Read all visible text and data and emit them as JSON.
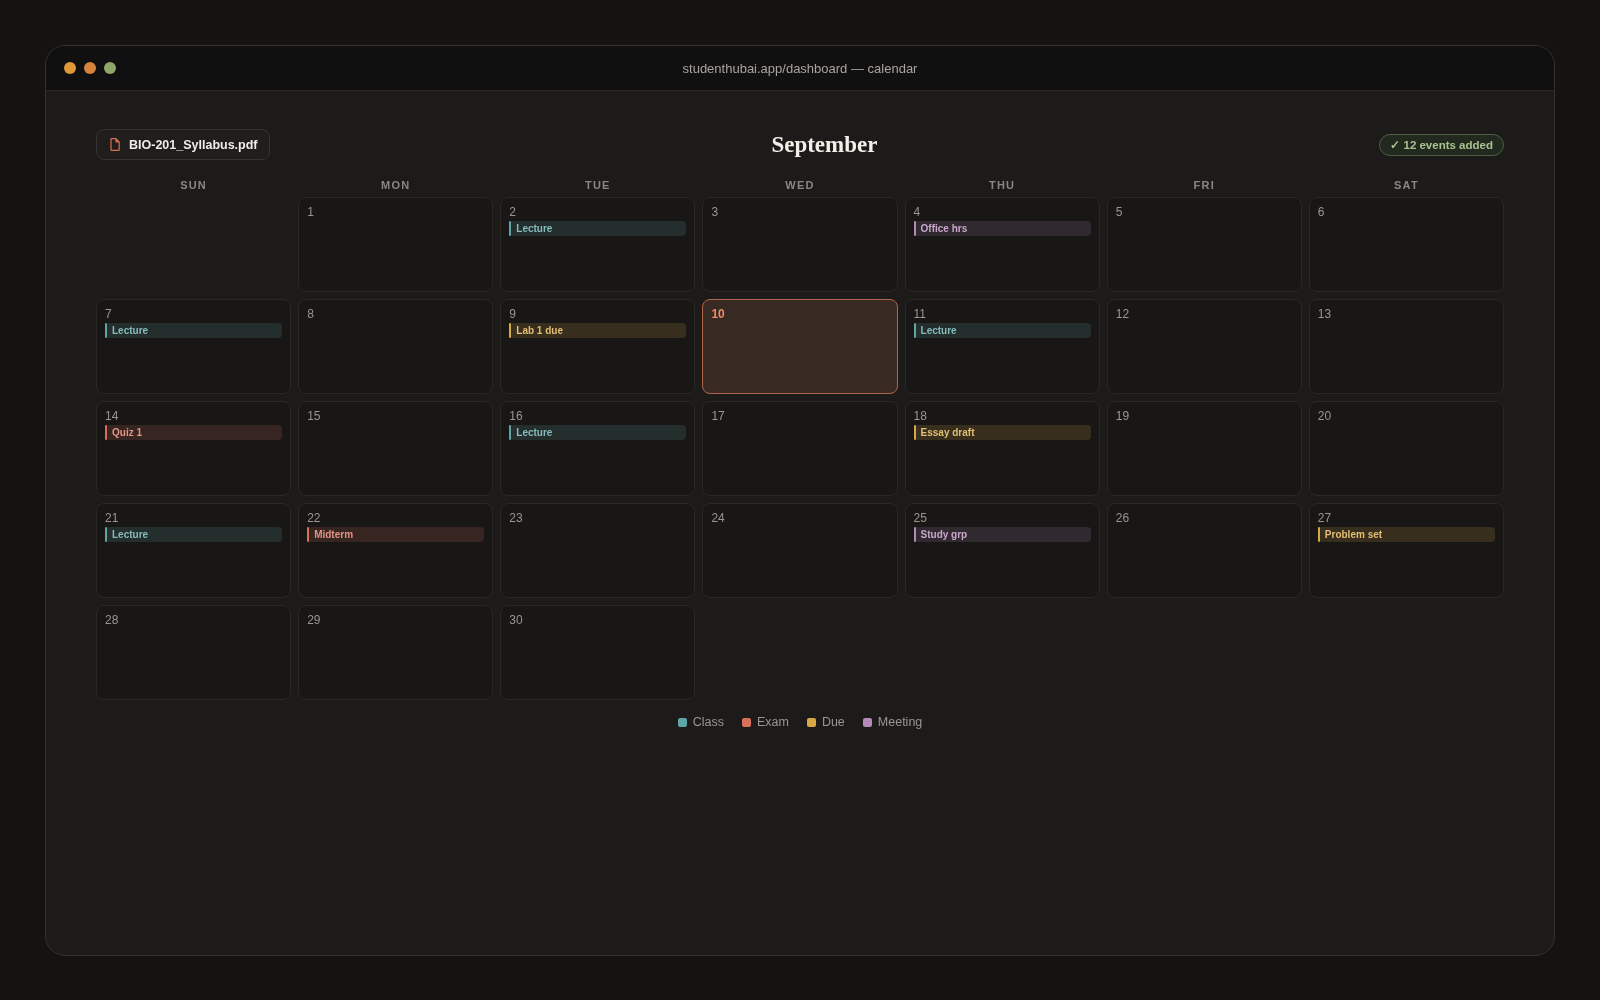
{
  "window": {
    "title": "studenthubai.app/dashboard — calendar"
  },
  "header": {
    "file_button": {
      "label": "BIO-201_Syllabus.pdf"
    },
    "month": "September",
    "status_badge": {
      "label": "✓ 12 events added"
    }
  },
  "weekdays": [
    "SUN",
    "MON",
    "TUE",
    "WED",
    "THU",
    "FRI",
    "SAT"
  ],
  "weeks": [
    {
      "days": [
        {
          "kind": "blank"
        },
        {
          "kind": "day",
          "date": "1",
          "today": false
        },
        {
          "kind": "day",
          "date": "2",
          "today": false,
          "events": [
            {
              "label": "Lecture",
              "color": "#5fa4a6"
            }
          ]
        },
        {
          "kind": "day",
          "date": "3",
          "today": false
        },
        {
          "kind": "day",
          "date": "4",
          "today": false,
          "events": [
            {
              "label": "Office hrs",
              "color": "#b48ab8"
            }
          ]
        },
        {
          "kind": "day",
          "date": "5",
          "today": false
        },
        {
          "kind": "day",
          "date": "6",
          "today": false
        }
      ]
    },
    {
      "days": [
        {
          "kind": "day",
          "date": "7",
          "today": false,
          "events": [
            {
              "label": "Lecture",
              "color": "#5fa4a6"
            }
          ]
        },
        {
          "kind": "day",
          "date": "8",
          "today": false
        },
        {
          "kind": "day",
          "date": "9",
          "today": false,
          "events": [
            {
              "label": "Lab 1 due",
              "color": "#d9a845"
            }
          ]
        },
        {
          "kind": "day",
          "date": "10",
          "today": true
        },
        {
          "kind": "day",
          "date": "11",
          "today": false,
          "events": [
            {
              "label": "Lecture",
              "color": "#5fa4a6"
            }
          ]
        },
        {
          "kind": "day",
          "date": "12",
          "today": false
        },
        {
          "kind": "day",
          "date": "13",
          "today": false
        }
      ]
    },
    {
      "days": [
        {
          "kind": "day",
          "date": "14",
          "today": false,
          "events": [
            {
              "label": "Quiz 1",
              "color": "#d9705a"
            }
          ]
        },
        {
          "kind": "day",
          "date": "15",
          "today": false
        },
        {
          "kind": "day",
          "date": "16",
          "today": false,
          "events": [
            {
              "label": "Lecture",
              "color": "#5fa4a6"
            }
          ]
        },
        {
          "kind": "day",
          "date": "17",
          "today": false
        },
        {
          "kind": "day",
          "date": "18",
          "today": false,
          "events": [
            {
              "label": "Essay draft",
              "color": "#d9a845"
            }
          ]
        },
        {
          "kind": "day",
          "date": "19",
          "today": false
        },
        {
          "kind": "day",
          "date": "20",
          "today": false
        }
      ]
    },
    {
      "days": [
        {
          "kind": "day",
          "date": "21",
          "today": false,
          "events": [
            {
              "label": "Lecture",
              "color": "#5fa4a6"
            }
          ]
        },
        {
          "kind": "day",
          "date": "22",
          "today": false,
          "events": [
            {
              "label": "Midterm",
              "color": "#d9705a"
            }
          ]
        },
        {
          "kind": "day",
          "date": "23",
          "today": false
        },
        {
          "kind": "day",
          "date": "24",
          "today": false
        },
        {
          "kind": "day",
          "date": "25",
          "today": false,
          "events": [
            {
              "label": "Study grp",
              "color": "#b48ab8"
            }
          ]
        },
        {
          "kind": "day",
          "date": "26",
          "today": false
        },
        {
          "kind": "day",
          "date": "27",
          "today": false,
          "events": [
            {
              "label": "Problem set",
              "color": "#d9a845"
            }
          ]
        }
      ]
    },
    {
      "days": [
        {
          "kind": "day",
          "date": "28",
          "today": false
        },
        {
          "kind": "day",
          "date": "29",
          "today": false
        },
        {
          "kind": "day",
          "date": "30",
          "today": false
        },
        {
          "kind": "blank"
        },
        {
          "kind": "blank"
        },
        {
          "kind": "blank"
        },
        {
          "kind": "blank"
        }
      ]
    }
  ],
  "legend": [
    {
      "label": "Class",
      "color": "#5fa4a6"
    },
    {
      "label": "Exam",
      "color": "#d9705a"
    },
    {
      "label": "Due",
      "color": "#d9a845"
    },
    {
      "label": "Meeting",
      "color": "#b48ab8"
    }
  ]
}
